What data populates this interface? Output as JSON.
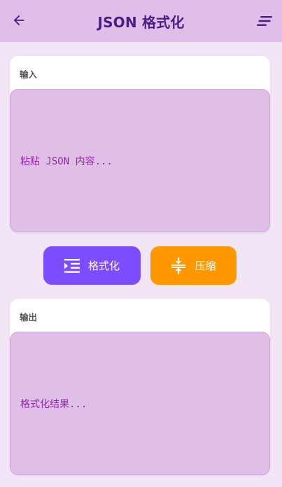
{
  "appbar": {
    "title": "JSON 格式化"
  },
  "input": {
    "label": "输入",
    "placeholder": "粘贴 JSON 内容..."
  },
  "buttons": {
    "format_label": "格式化",
    "compress_label": "压缩"
  },
  "output": {
    "label": "输出",
    "placeholder": "格式化结果..."
  },
  "colors": {
    "appbar_bg": "#dfbfe7",
    "title": "#4a1d86",
    "format_button": "#7c4dff",
    "compress_button": "#ff9800",
    "field_bg": "#e0bfe7",
    "field_text": "#8e2aa7"
  },
  "icons": {
    "back": "arrow-left-icon",
    "menu": "sort-lines-icon",
    "format": "format-indent-icon",
    "compress": "compress-vertical-icon"
  }
}
